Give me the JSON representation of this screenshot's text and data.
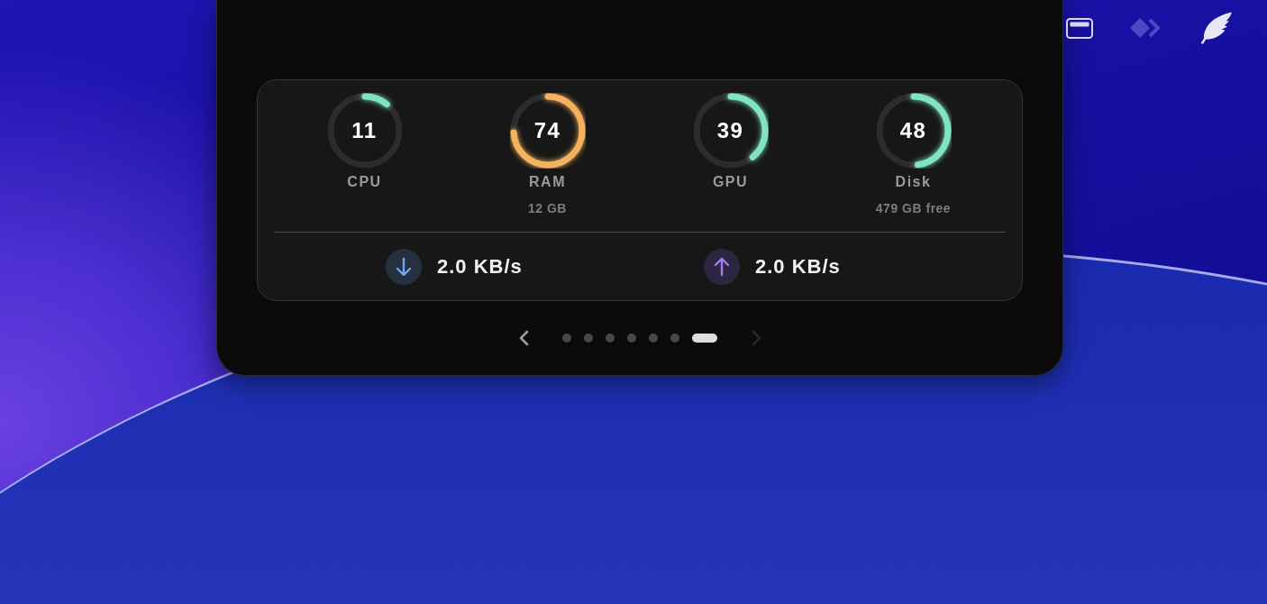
{
  "status_icons": [
    {
      "kind": "window",
      "dimmed": false
    },
    {
      "kind": "diamond-chevron",
      "dimmed": true
    },
    {
      "kind": "feather",
      "dimmed": false
    }
  ],
  "gauges": [
    {
      "value": "11",
      "label": "CPU",
      "level": 0.11,
      "color": "#7fe3bd"
    },
    {
      "value": "74",
      "label": "RAM",
      "detail": "12 GB",
      "level": 0.74,
      "color": "#f5b25e"
    },
    {
      "value": "39",
      "label": "GPU",
      "level": 0.39,
      "color": "#7fe3c4"
    },
    {
      "value": "48",
      "label": "Disk",
      "detail": "479 GB free",
      "level": 0.48,
      "color": "#7fe3c4"
    }
  ],
  "network": [
    {
      "kind": "download",
      "rate": "2.0 KB/s"
    },
    {
      "kind": "upload",
      "rate": "2.0 KB/s"
    }
  ],
  "pager": {
    "previous": {
      "disabled": false
    },
    "next": {
      "disabled": true
    },
    "pages": [
      {
        "selected": false
      },
      {
        "selected": false
      },
      {
        "selected": false
      },
      {
        "selected": false
      },
      {
        "selected": false
      },
      {
        "selected": false
      },
      {
        "selected": true
      }
    ]
  }
}
